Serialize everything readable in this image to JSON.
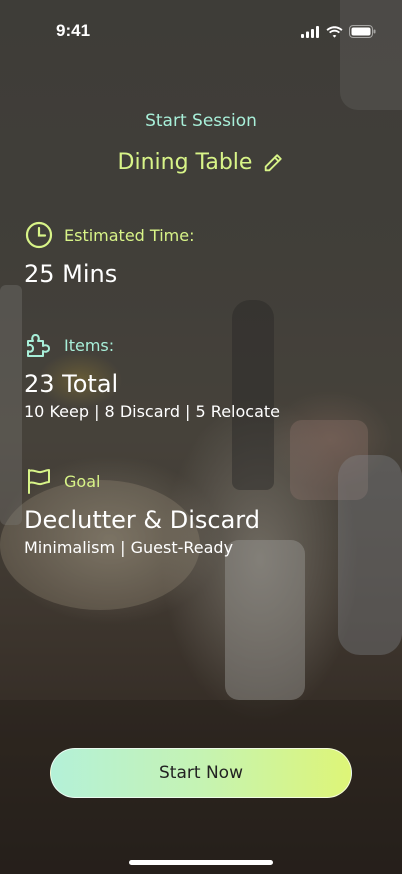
{
  "status_bar": {
    "time": "9:41"
  },
  "header": {
    "session_label": "Start Session",
    "title": "Dining Table"
  },
  "estimated_time": {
    "label": "Estimated Time:",
    "value": "25 Mins"
  },
  "items": {
    "label": "Items:",
    "total": "23 Total",
    "breakdown": "10 Keep | 8 Discard | 5 Relocate"
  },
  "goal": {
    "label": "Goal",
    "value": "Declutter & Discard",
    "tags": "Minimalism | Guest-Ready"
  },
  "actions": {
    "start_label": "Start Now"
  },
  "colors": {
    "lime": "#d8f488",
    "mint": "#a8efd9",
    "button_gradient_start": "#b4f1d8",
    "button_gradient_end": "#def577"
  },
  "icons": {
    "edit": "pencil-icon",
    "time": "clock-icon",
    "items": "puzzle-icon",
    "goal": "flag-icon"
  }
}
